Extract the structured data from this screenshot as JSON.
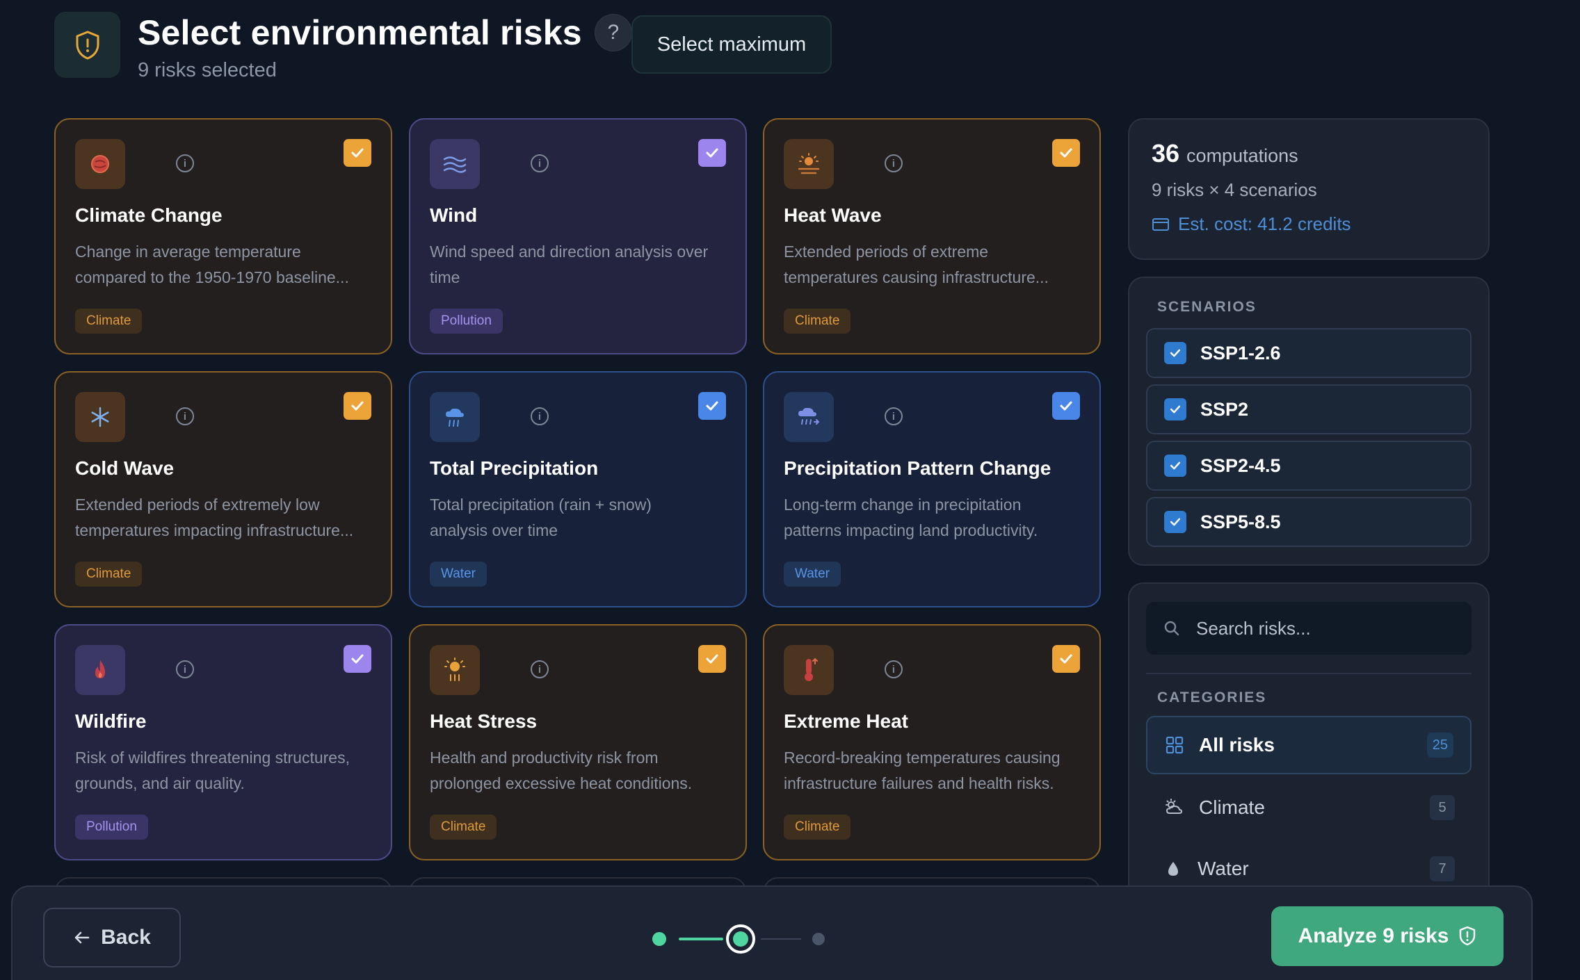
{
  "header": {
    "title": "Select environmental risks",
    "help_label": "?",
    "subtitle": "9 risks selected",
    "select_max_label": "Select maximum"
  },
  "cards": [
    {
      "name": "Climate Change",
      "desc_line1": "Change in average temperature",
      "desc_line2": "compared to the 1950-1970 baseline...",
      "tag": "Climate",
      "icon": "thermometer-globe-icon",
      "checked": true
    },
    {
      "name": "Wind",
      "desc_line1": "Wind speed and direction analysis over",
      "desc_line2": "time",
      "tag": "Pollution",
      "icon": "wind-icon",
      "checked": true
    },
    {
      "name": "Heat Wave",
      "desc_line1": "Extended periods of extreme",
      "desc_line2": "temperatures causing infrastructure...",
      "tag": "Climate",
      "icon": "sun-horizon-icon",
      "checked": true
    },
    {
      "name": "Cold Wave",
      "desc_line1": "Extended periods of extremely low",
      "desc_line2": "temperatures impacting infrastructure...",
      "tag": "Climate",
      "icon": "snowflake-icon",
      "checked": true
    },
    {
      "name": "Total Precipitation",
      "desc_line1": "Total precipitation (rain + snow)",
      "desc_line2": "analysis over time",
      "tag": "Water",
      "icon": "rain-cloud-icon",
      "checked": true
    },
    {
      "name": "Precipitation Pattern Change",
      "desc_line1": "Long-term change in precipitation",
      "desc_line2": "patterns impacting land productivity.",
      "tag": "Water",
      "icon": "cloud-rain-change-icon",
      "checked": true
    },
    {
      "name": "Wildfire",
      "desc_line1": "Risk of wildfires threatening structures,",
      "desc_line2": "grounds, and air quality.",
      "tag": "Pollution",
      "icon": "flame-icon",
      "checked": true
    },
    {
      "name": "Heat Stress",
      "desc_line1": "Health and productivity risk from",
      "desc_line2": "prolonged excessive heat conditions.",
      "tag": "Climate",
      "icon": "sun-stress-icon",
      "checked": true
    },
    {
      "name": "Extreme Heat",
      "desc_line1": "Record-breaking temperatures causing",
      "desc_line2": "infrastructure failures and health risks.",
      "tag": "Climate",
      "icon": "thermometer-up-icon",
      "checked": true
    }
  ],
  "summary": {
    "count": "36",
    "count_label": "computations",
    "formula": "9 risks × 4 scenarios",
    "cost": "Est. cost: 41.2 credits"
  },
  "scenarios": {
    "heading": "SCENARIOS",
    "items": [
      {
        "label": "SSP1-2.6",
        "checked": true
      },
      {
        "label": "SSP2",
        "checked": true
      },
      {
        "label": "SSP2-4.5",
        "checked": true
      },
      {
        "label": "SSP5-8.5",
        "checked": true
      }
    ]
  },
  "filters": {
    "search_placeholder": "Search risks...",
    "heading": "CATEGORIES",
    "categories": [
      {
        "label": "All risks",
        "count": "25",
        "icon": "grid-icon",
        "active": true
      },
      {
        "label": "Climate",
        "count": "5",
        "icon": "weather-icon",
        "active": false
      },
      {
        "label": "Water",
        "count": "7",
        "icon": "droplet-icon",
        "active": false
      }
    ]
  },
  "footer": {
    "back_label": "Back",
    "analyze_label": "Analyze 9 risks",
    "step": "2 of 3"
  },
  "colors": {
    "climate": "#eca338",
    "pollution": "#9c86ee",
    "water": "#4a86e8",
    "primary": "#3fa87e",
    "background": "#0f1624"
  }
}
